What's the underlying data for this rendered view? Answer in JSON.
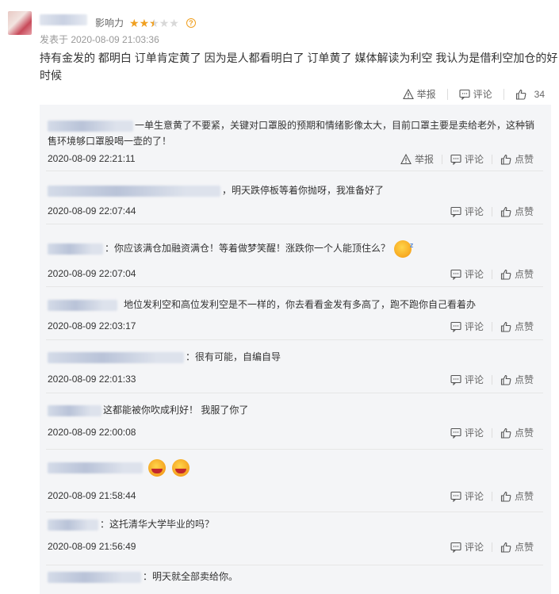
{
  "post": {
    "influence_label": "影响力",
    "rating": 2.5,
    "time": "发表于 2020-08-09 21:03:36",
    "text": "持有金发的 都明白 订单肯定黄了 因为是人都看明白了 订单黄了 媒体解读为利空 我认为是借利空加仓的好时候",
    "actions": {
      "report": "举报",
      "comment": "评论",
      "likes": "34"
    }
  },
  "reply_actions": {
    "report": "举报",
    "comment": "评论",
    "like": "点赞"
  },
  "replies": [
    {
      "text": "一单生意黄了不要紧，关键对口罩股的预期和情绪影像太大，目前口罩主要是卖给老外，这种销售环境够口罩股喝一壶的了！",
      "time": "2020-08-09 22:21:11"
    },
    {
      "text": "，明天跌停板等着你抛呀，我准备好了",
      "time": "2020-08-09 22:07:44"
    },
    {
      "text": "：你应该满仓加融资满仓！等着做梦笑醒！涨跌你一个人能顶住么？",
      "time": "2020-08-09 22:07:04"
    },
    {
      "text": "地位发利空和高位发利空是不一样的，你去看看金发有多高了，跑不跑你自己看着办",
      "time": "2020-08-09 22:03:17"
    },
    {
      "text": "：很有可能，自编自导",
      "time": "2020-08-09 22:01:33"
    },
    {
      "text": "这都能被你吹成利好！ 我服了你了",
      "time": "2020-08-09 22:00:08"
    },
    {
      "text": "",
      "time": "2020-08-09 21:58:44"
    },
    {
      "text": "：这托清华大学毕业的吗？",
      "time": "2020-08-09 21:56:49"
    },
    {
      "text": "：明天就全部卖给你。",
      "time": ""
    }
  ]
}
